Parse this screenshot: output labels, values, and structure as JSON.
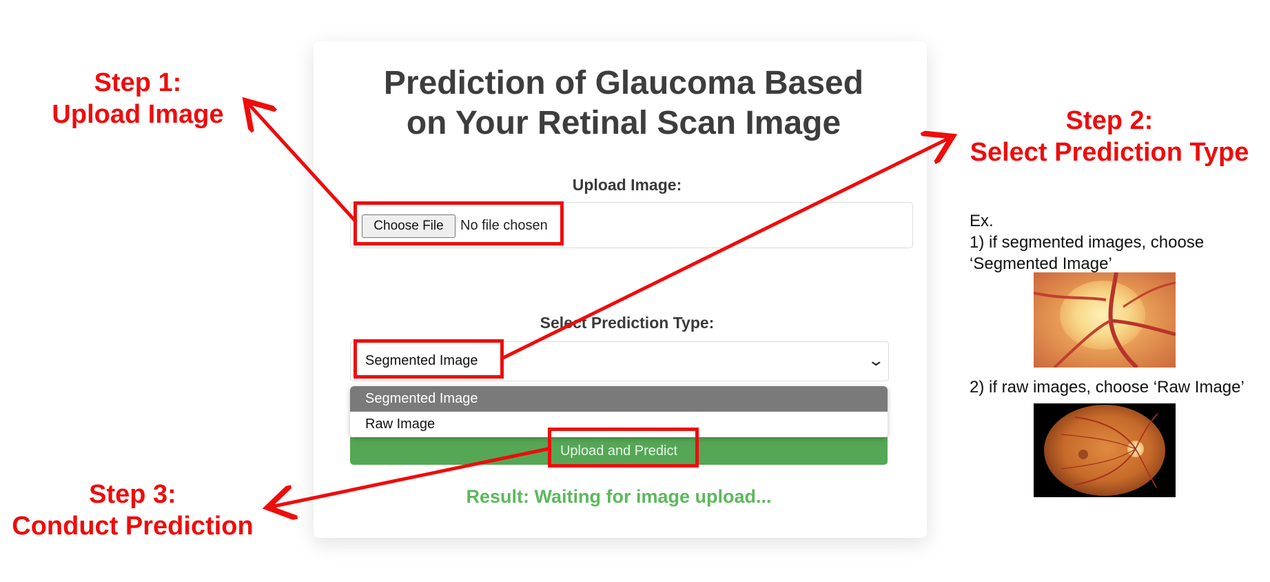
{
  "page": {
    "title_line1": "Prediction of Glaucoma Based",
    "title_line2": "on Your Retinal Scan Image"
  },
  "upload": {
    "label": "Upload Image:",
    "choose_button": "Choose File",
    "file_status": "No file chosen"
  },
  "prediction": {
    "label": "Select Prediction Type:",
    "selected": "Segmented Image",
    "options": [
      "Segmented Image",
      "Raw Image"
    ],
    "submit_button": "Upload and Predict"
  },
  "result": {
    "text": "Result: Waiting for image upload..."
  },
  "annotations": {
    "step1_line1": "Step 1:",
    "step1_line2": "Upload Image",
    "step2_line1": "Step 2:",
    "step2_line2": "Select Prediction Type",
    "step3_line1": "Step 3:",
    "step3_line2": "Conduct Prediction",
    "ex_label": "Ex.",
    "ex1_line1": "1) if segmented images, choose",
    "ex1_line2": "‘Segmented Image’",
    "ex2": "2) if raw images, choose ‘Raw Image’"
  },
  "colors": {
    "annotation_red": "#ee0c0c",
    "button_green": "#55a756",
    "result_green": "#5cb85c",
    "title_gray": "#3d3d3d"
  }
}
